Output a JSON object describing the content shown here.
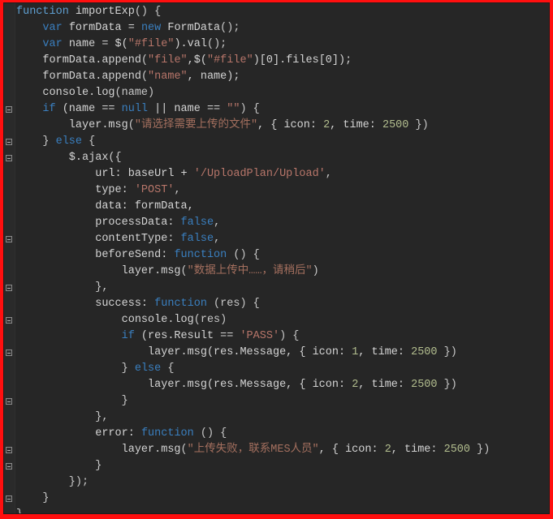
{
  "window": {
    "kind": "code-editor-snippet",
    "language": "JavaScript",
    "border_color": "#ff0f0f",
    "background_color": "#262626",
    "default_text_color": "#d4d4d4"
  },
  "theme": {
    "keyword_color": "#3a7fbf",
    "function_keyword_color": "#5f9fd0",
    "string_color": "#b8766a",
    "number_color": "#b3be8f",
    "punctuation_color": "#c8c8c8"
  },
  "fold_markers": [
    {
      "line": 7
    },
    {
      "line": 9
    },
    {
      "line": 10
    },
    {
      "line": 15
    },
    {
      "line": 18
    },
    {
      "line": 20
    },
    {
      "line": 22
    },
    {
      "line": 25
    },
    {
      "line": 28
    },
    {
      "line": 29
    },
    {
      "line": 31
    }
  ],
  "code": {
    "lines": [
      [
        {
          "t": "function",
          "c": "fnkw"
        },
        {
          "t": " importExp",
          "c": "plain"
        },
        {
          "t": "() {",
          "c": "punc"
        }
      ],
      [
        {
          "t": "    ",
          "c": "plain"
        },
        {
          "t": "var",
          "c": "kw"
        },
        {
          "t": " formData = ",
          "c": "plain"
        },
        {
          "t": "new",
          "c": "kw"
        },
        {
          "t": " FormData",
          "c": "plain"
        },
        {
          "t": "();",
          "c": "punc"
        }
      ],
      [
        {
          "t": "    ",
          "c": "plain"
        },
        {
          "t": "var",
          "c": "kw"
        },
        {
          "t": " name = $(",
          "c": "plain"
        },
        {
          "t": "\"#file\"",
          "c": "str"
        },
        {
          "t": ").val",
          "c": "plain"
        },
        {
          "t": "();",
          "c": "punc"
        }
      ],
      [
        {
          "t": "    formData.append",
          "c": "plain"
        },
        {
          "t": "(",
          "c": "punc"
        },
        {
          "t": "\"file\"",
          "c": "str"
        },
        {
          "t": ",$(",
          "c": "plain"
        },
        {
          "t": "\"#file\"",
          "c": "str"
        },
        {
          "t": ")[0].files[0]);",
          "c": "plain"
        }
      ],
      [
        {
          "t": "    formData.append",
          "c": "plain"
        },
        {
          "t": "(",
          "c": "punc"
        },
        {
          "t": "\"name\"",
          "c": "str"
        },
        {
          "t": ", name);",
          "c": "plain"
        }
      ],
      [
        {
          "t": "    console.log",
          "c": "plain"
        },
        {
          "t": "(name)",
          "c": "punc"
        }
      ],
      [
        {
          "t": "    ",
          "c": "plain"
        },
        {
          "t": "if",
          "c": "kw"
        },
        {
          "t": " (name == ",
          "c": "plain"
        },
        {
          "t": "null",
          "c": "kw"
        },
        {
          "t": " || name == ",
          "c": "plain"
        },
        {
          "t": "\"\"",
          "c": "str"
        },
        {
          "t": ") {",
          "c": "punc"
        }
      ],
      [
        {
          "t": "        layer.msg",
          "c": "plain"
        },
        {
          "t": "(",
          "c": "punc"
        },
        {
          "t": "\"请选择需要上传的文件\"",
          "c": "str-cn"
        },
        {
          "t": ", { icon: ",
          "c": "plain"
        },
        {
          "t": "2",
          "c": "num"
        },
        {
          "t": ", time: ",
          "c": "plain"
        },
        {
          "t": "2500",
          "c": "num"
        },
        {
          "t": " })",
          "c": "punc"
        }
      ],
      [
        {
          "t": "    } ",
          "c": "punc"
        },
        {
          "t": "else",
          "c": "kw"
        },
        {
          "t": " {",
          "c": "punc"
        }
      ],
      [
        {
          "t": "        $.ajax",
          "c": "plain"
        },
        {
          "t": "({",
          "c": "punc"
        }
      ],
      [
        {
          "t": "            url: baseUrl + ",
          "c": "plain"
        },
        {
          "t": "'/UploadPlan/Upload'",
          "c": "str"
        },
        {
          "t": ",",
          "c": "punc"
        }
      ],
      [
        {
          "t": "            type: ",
          "c": "plain"
        },
        {
          "t": "'POST'",
          "c": "str"
        },
        {
          "t": ",",
          "c": "punc"
        }
      ],
      [
        {
          "t": "            data: formData,",
          "c": "plain"
        }
      ],
      [
        {
          "t": "            processData: ",
          "c": "plain"
        },
        {
          "t": "false",
          "c": "kw"
        },
        {
          "t": ",",
          "c": "punc"
        }
      ],
      [
        {
          "t": "            contentType: ",
          "c": "plain"
        },
        {
          "t": "false",
          "c": "kw"
        },
        {
          "t": ",",
          "c": "punc"
        }
      ],
      [
        {
          "t": "            beforeSend: ",
          "c": "plain"
        },
        {
          "t": "function",
          "c": "kw"
        },
        {
          "t": " () {",
          "c": "punc"
        }
      ],
      [
        {
          "t": "                layer.msg",
          "c": "plain"
        },
        {
          "t": "(",
          "c": "punc"
        },
        {
          "t": "\"数据上传中……，请稍后\"",
          "c": "str-cn"
        },
        {
          "t": ")",
          "c": "punc"
        }
      ],
      [
        {
          "t": "            },",
          "c": "punc"
        }
      ],
      [
        {
          "t": "            success: ",
          "c": "plain"
        },
        {
          "t": "function",
          "c": "kw"
        },
        {
          "t": " (res) {",
          "c": "punc"
        }
      ],
      [
        {
          "t": "                console.log",
          "c": "plain"
        },
        {
          "t": "(res)",
          "c": "punc"
        }
      ],
      [
        {
          "t": "                ",
          "c": "plain"
        },
        {
          "t": "if",
          "c": "kw"
        },
        {
          "t": " (res.Result == ",
          "c": "plain"
        },
        {
          "t": "'PASS'",
          "c": "str"
        },
        {
          "t": ") {",
          "c": "punc"
        }
      ],
      [
        {
          "t": "                    layer.msg",
          "c": "plain"
        },
        {
          "t": "(res.Message, { icon: ",
          "c": "plain"
        },
        {
          "t": "1",
          "c": "num"
        },
        {
          "t": ", time: ",
          "c": "plain"
        },
        {
          "t": "2500",
          "c": "num"
        },
        {
          "t": " })",
          "c": "punc"
        }
      ],
      [
        {
          "t": "                } ",
          "c": "punc"
        },
        {
          "t": "else",
          "c": "kw"
        },
        {
          "t": " {",
          "c": "punc"
        }
      ],
      [
        {
          "t": "                    layer.msg",
          "c": "plain"
        },
        {
          "t": "(res.Message, { icon: ",
          "c": "plain"
        },
        {
          "t": "2",
          "c": "num"
        },
        {
          "t": ", time: ",
          "c": "plain"
        },
        {
          "t": "2500",
          "c": "num"
        },
        {
          "t": " })",
          "c": "punc"
        }
      ],
      [
        {
          "t": "                }",
          "c": "punc"
        }
      ],
      [
        {
          "t": "            },",
          "c": "punc"
        }
      ],
      [
        {
          "t": "            error: ",
          "c": "plain"
        },
        {
          "t": "function",
          "c": "kw"
        },
        {
          "t": " () {",
          "c": "punc"
        }
      ],
      [
        {
          "t": "                layer.msg",
          "c": "plain"
        },
        {
          "t": "(",
          "c": "punc"
        },
        {
          "t": "\"上传失败，联系MES人员\"",
          "c": "str-cn"
        },
        {
          "t": ", { icon: ",
          "c": "plain"
        },
        {
          "t": "2",
          "c": "num"
        },
        {
          "t": ", time: ",
          "c": "plain"
        },
        {
          "t": "2500",
          "c": "num"
        },
        {
          "t": " })",
          "c": "punc"
        }
      ],
      [
        {
          "t": "            }",
          "c": "punc"
        }
      ],
      [
        {
          "t": "        });",
          "c": "punc"
        }
      ],
      [
        {
          "t": "    }",
          "c": "punc"
        }
      ],
      [
        {
          "t": "}",
          "c": "punc"
        }
      ]
    ]
  }
}
